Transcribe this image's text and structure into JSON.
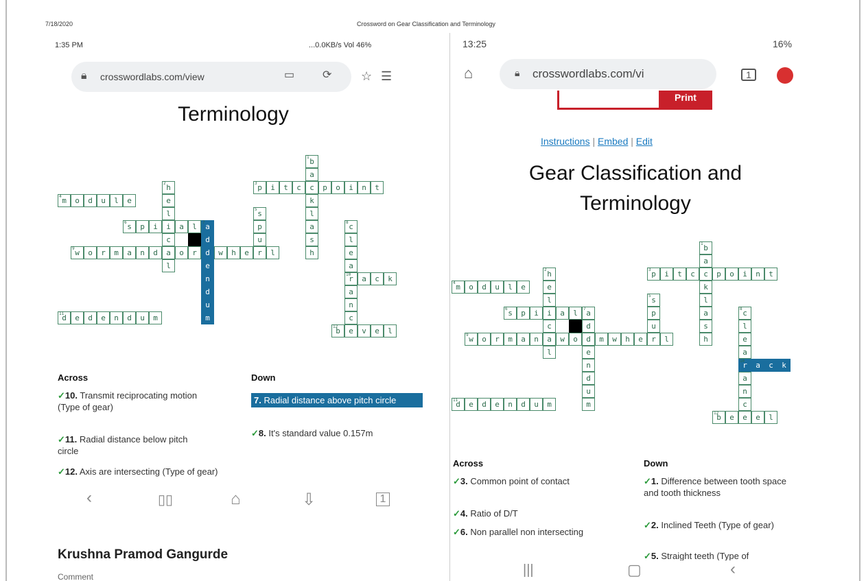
{
  "print_header": {
    "date": "7/18/2020",
    "title": "Crossword on Gear Classification and Terminology"
  },
  "left_phone": {
    "status": {
      "time": "1:35 PM",
      "right": "...0.0KB/s  Vol  46%"
    },
    "url": "crosswordlabs.com/view",
    "title": "Terminology",
    "across_head": "Across",
    "down_head": "Down",
    "across": [
      {
        "num": "10.",
        "text": "Transmit reciprocating motion (Type of gear)"
      },
      {
        "num": "11.",
        "text": "Radial distance below pitch circle"
      },
      {
        "num": "12.",
        "text": "Axis are intersecting (Type of gear)"
      }
    ],
    "down": [
      {
        "num": "7.",
        "text": "Radial distance above pitch circle"
      },
      {
        "num": "8.",
        "text": "It's standard value 0.157m"
      }
    ],
    "author": "Krushna Pramod Gangurde",
    "comment": "Comment"
  },
  "right_phone": {
    "status": {
      "time": "13:25",
      "right": "16%"
    },
    "url": "crosswordlabs.com/vi",
    "print_label": "Print",
    "links": {
      "instructions": "Instructions",
      "sep": " | ",
      "embed": "Embed",
      "edit": "Edit"
    },
    "title_line1": "Gear Classification and",
    "title_line2": "Terminology",
    "across_head": "Across",
    "down_head": "Down",
    "across": [
      {
        "num": "3.",
        "text": "Common point of contact"
      },
      {
        "num": "4.",
        "text": "Ratio of D/T"
      },
      {
        "num": "6.",
        "text": "Non parallel non intersecting"
      }
    ],
    "down": [
      {
        "num": "1.",
        "text": "Difference between tooth space and tooth thickness"
      },
      {
        "num": "2.",
        "text": "Inclined Teeth (Type of gear)"
      },
      {
        "num": "5.",
        "text": "Straight teeth (Type of"
      }
    ]
  },
  "colors": {
    "accent": "#1a6e9e",
    "check": "#2a9a3a",
    "cell_border": "#4a8a6a",
    "print_red": "#c8202a"
  }
}
